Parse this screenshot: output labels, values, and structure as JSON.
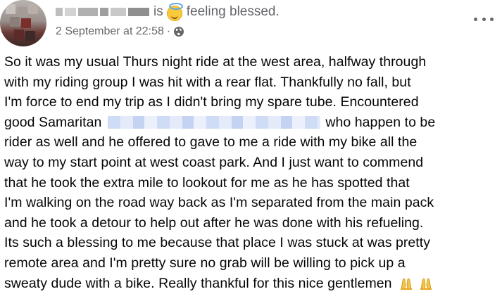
{
  "post": {
    "author": {
      "avatar_icon": "profile-avatar-blurred"
    },
    "header": {
      "verb": "is",
      "feeling_icon": "smiling-face-with-halo-icon",
      "feeling": "feeling blessed."
    },
    "timestamp": "2 September at 22:58",
    "separator": "·",
    "privacy_icon": "globe-icon",
    "more_icon": "more-options-icon",
    "body_lines": [
      "So it was my usual Thurs night ride at the west area, halfway through",
      "with my riding group I was hit with a rear flat. Thankfully no fall, but",
      "I'm force to end my trip as I didn't bring my spare tube. Encountered",
      "good Samaritan",
      "who happen to be",
      "rider as well and he offered to gave to me a ride with my bike all the",
      "way to my start point at west coast park. And I just want to commend",
      "that he took the extra mile to lookout for me as he has spotted that",
      "I'm walking on the road way back as I'm separated from the main pack",
      "and he took a detour to help out after he was done with his refueling.",
      "Its such a blessing to me because that place I was stuck at was pretty",
      "remote area and I'm pretty sure no grab will be willing to pick up a",
      "sweaty dude with a bike. Really thankful for this nice gentlemen"
    ],
    "trailing_emoji": "folded-hands-icon"
  },
  "colors": {
    "text_primary": "#050505",
    "text_secondary": "#65676b",
    "redaction": "#c7d6f3"
  }
}
